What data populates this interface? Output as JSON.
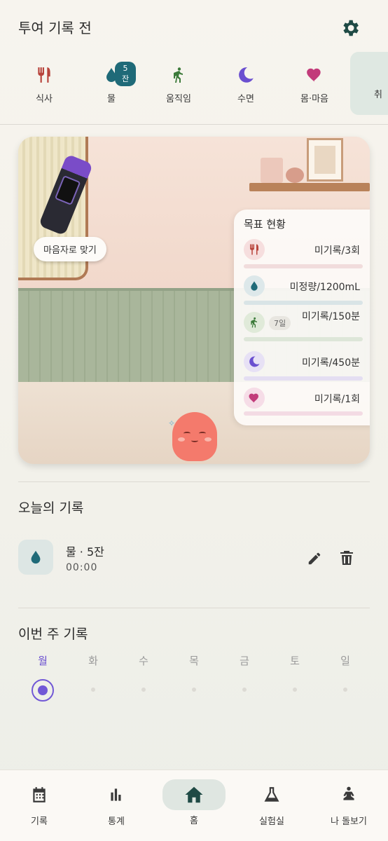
{
  "header": {
    "title": "투여 기록 전"
  },
  "categories": [
    {
      "label": "식사",
      "icon": "utensils-icon",
      "color": "#b8443c"
    },
    {
      "label": "물",
      "icon": "water-drop-icon",
      "color": "#1f6a78",
      "badge": "5잔"
    },
    {
      "label": "움직임",
      "icon": "walking-icon",
      "color": "#3c7a3a"
    },
    {
      "label": "수면",
      "icon": "moon-icon",
      "color": "#6a4fd0"
    },
    {
      "label": "몸·마음",
      "icon": "heart-icon",
      "color": "#c23b7a"
    },
    {
      "label": "취"
    }
  ],
  "scene": {
    "tag": "마음자로 맞기",
    "goals": {
      "title": "목표 현황",
      "items": [
        {
          "icon": "utensils-icon",
          "value": "미기록/3회",
          "bar_color": "#f1dcdc",
          "icon_bg": "#f6dede",
          "icon_color": "#b8443c"
        },
        {
          "icon": "water-drop-icon",
          "value": "미정량/1200mL",
          "bar_color": "#d9e4e6",
          "icon_bg": "#dde8ea",
          "icon_color": "#1f6a78"
        },
        {
          "icon": "walking-icon",
          "value": "미기록/150분",
          "days": "7일",
          "bar_color": "#dde6d8",
          "icon_bg": "#e0ead9",
          "icon_color": "#3c7a3a"
        },
        {
          "icon": "moon-icon",
          "value": "미기록/450분",
          "bar_color": "#e4def2",
          "icon_bg": "#e7e1f5",
          "icon_color": "#6a4fd0"
        },
        {
          "icon": "heart-icon",
          "value": "미기록/1회",
          "bar_color": "#f3dbe4",
          "icon_bg": "#f6dde7",
          "icon_color": "#c23b7a"
        }
      ]
    }
  },
  "today": {
    "title": "오늘의 기록",
    "items": [
      {
        "name": "물 · 5잔",
        "time": "00:00",
        "icon": "water-drop-icon"
      }
    ]
  },
  "week": {
    "title": "이번 주 기록",
    "days": [
      "월",
      "화",
      "수",
      "목",
      "금",
      "토",
      "일"
    ],
    "active_index": 0
  },
  "nav": {
    "items": [
      {
        "label": "기록",
        "icon": "calendar-icon"
      },
      {
        "label": "통계",
        "icon": "bar-chart-icon"
      },
      {
        "label": "홈",
        "icon": "home-icon",
        "active": true
      },
      {
        "label": "실험실",
        "icon": "flask-icon"
      },
      {
        "label": "나 돌보기",
        "icon": "meditation-icon"
      }
    ]
  },
  "colors": {
    "accent": "#1f6a78",
    "purple": "#6a4fd0",
    "pet": "#f47a6c"
  }
}
